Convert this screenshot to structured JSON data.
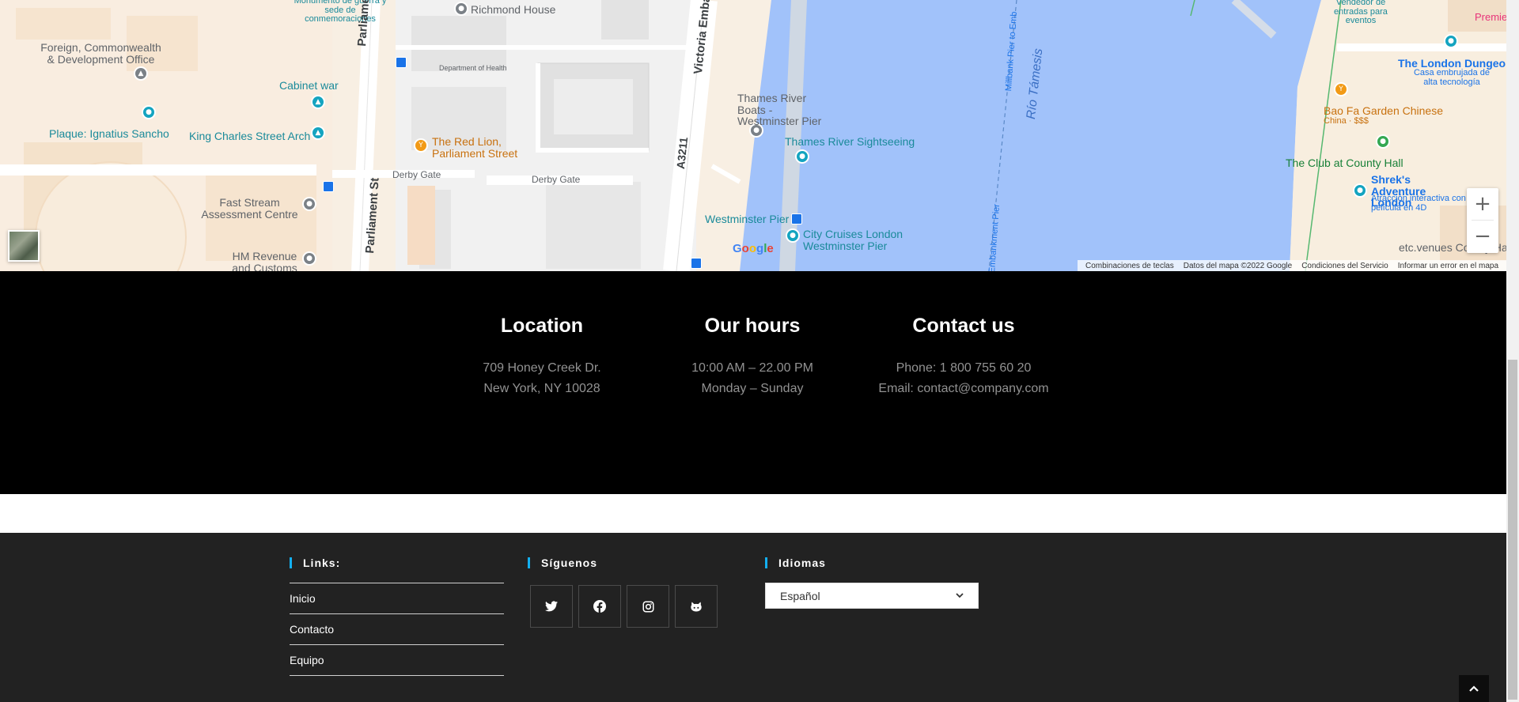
{
  "map": {
    "labels": {
      "monument": "Monumento de guerra y sede de conmemoraciones",
      "richmond_house": "Richmond House",
      "foreign_office": "Foreign, Commonwealth & Development Office",
      "cabinet_war": "Cabinet war",
      "plaque": "Plaque: Ignatius Sancho",
      "king_charles": "King Charles Street Arch",
      "parliament_st_1": "Parliament St",
      "parliament_st_2": "Parliament St",
      "department_health": "Department of Health",
      "victoria_embankment": "Victoria Emba",
      "red_lion": "The Red Lion, Parliament Street",
      "derby_gate_1": "Derby Gate",
      "derby_gate_2": "Derby Gate",
      "a3211": "A3211",
      "fast_stream": "Fast Stream Assessment Centre",
      "hm_revenue": "HM Revenue and Customs",
      "thames_boats": "Thames River Boats - Westminster Pier",
      "thames_sightseeing": "Thames River Sightseeing",
      "westminster_pier": "Westminster Pier",
      "city_cruises": "City Cruises London Westminster Pier",
      "millbank_pier": "Millbank Pier to Emb",
      "embankment_pier": "Embankment Pier",
      "rio_tamesis": "Río Támesis",
      "vendor": "Vendedor de entradas para eventos",
      "premier": "Premie",
      "london_dungeon": "The London Dungeon",
      "london_dungeon_sub": "Casa embrujada de alta tecnología",
      "bao_fa": "Bao Fa Garden Chinese",
      "bao_fa_sub": "China · $$$",
      "club_county": "The Club at County Hall",
      "shrek": "Shrek's Adventure London",
      "shrek_sub": "Atracción interactiva con película en 4D",
      "etc_venues": "etc.venues County Ha"
    },
    "zoom_in": "+",
    "zoom_out": "−",
    "google_logo": "Google",
    "attribution": {
      "shortcuts": "Combinaciones de teclas",
      "map_data": "Datos del mapa ©2022 Google",
      "terms": "Condiciones del Servicio",
      "report": "Informar un error en el mapa"
    }
  },
  "info": {
    "location": {
      "title": "Location",
      "line1": "709 Honey Creek Dr.",
      "line2": "New York, NY 10028"
    },
    "hours": {
      "title": "Our hours",
      "line1": "10:00 AM – 22.00 PM",
      "line2": "Monday – Sunday"
    },
    "contact": {
      "title": "Contact us",
      "line1": "Phone: 1 800 755 60 20",
      "line2": "Email: contact@company.com"
    }
  },
  "footer": {
    "links_title": "Links:",
    "links": [
      "Inicio",
      "Contacto",
      "Equipo"
    ],
    "social_title": "Síguenos",
    "social_icons": [
      "twitter-icon",
      "facebook-icon",
      "instagram-icon",
      "github-icon"
    ],
    "languages_title": "Idiomas",
    "language_selected": "Español"
  },
  "colors": {
    "accent": "#13aff0",
    "water": "#a1c2fa",
    "black_section": "#000000",
    "dark_section": "#222222"
  }
}
